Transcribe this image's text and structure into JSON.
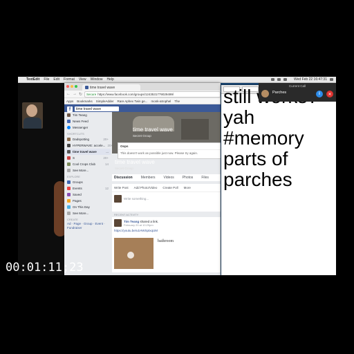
{
  "menubar": {
    "app": "TextEdit",
    "items": [
      "File",
      "Edit",
      "Format",
      "View",
      "Window",
      "Help"
    ],
    "clock": "Wed Feb 22  16:47:31"
  },
  "browser": {
    "tab_title": "time travel wave",
    "url_secure": "Secure",
    "url": "https://www.facebook.com/groups/1243531779029499/",
    "bookmarks": [
      "Apps",
      "Bookmarks",
      "SimpleAdder",
      "Rare Aphex Twin ge...",
      "monk-atrophel",
      "The"
    ]
  },
  "facebook": {
    "search_value": "time travel wave",
    "sidebar": {
      "user": "Tim Teang",
      "news_feed": "News Feed",
      "messenger": "Messenger",
      "shortcuts_header": "SHORTCUTS",
      "shortcuts": [
        {
          "label": "Dadspotting",
          "count": "20+"
        },
        {
          "label": "HYPERWAVE: accele...",
          "count": "20+"
        },
        {
          "label": "time travel wave",
          "count": "..."
        },
        {
          "label": "S",
          "count": "20+"
        },
        {
          "label": "Cool Crops Club",
          "count": "14"
        }
      ],
      "see_more_1": "See More...",
      "explore_header": "EXPLORE",
      "explore": [
        {
          "label": "Groups",
          "count": ""
        },
        {
          "label": "Events",
          "count": "12"
        },
        {
          "label": "Saved",
          "count": ""
        },
        {
          "label": "Pages",
          "count": ""
        },
        {
          "label": "On This Day",
          "count": ""
        }
      ],
      "see_more_2": "See More...",
      "create_header": "CREATE",
      "create_links": "Ad · Page · Group · Event · Fundraiser"
    },
    "cover": {
      "title": "time travel wave",
      "subtitle": "Secret Group"
    },
    "popup": {
      "title": "Oops",
      "message": "This doesn't work as possible just now. Please try again."
    },
    "group_title": "time travel wave",
    "group_subtitle": "Secret Group",
    "tabs": [
      "Discussion",
      "Members",
      "Videos",
      "Photos",
      "Files"
    ],
    "composer": {
      "write_post": "Write Post",
      "add_photo": "Add Photo/Video",
      "create_poll": "Create Poll",
      "more": "More",
      "placeholder": "Write something..."
    },
    "recent_activity": "RECENT ACTIVITY",
    "post": {
      "author": "Tim Teang",
      "action": "shared a link.",
      "time": "February 20 at 10:29pm",
      "link": "https://youtu.be/u1HWSptxqUM",
      "preview_title": "bathroom"
    }
  },
  "textedit": {
    "lines": [
      "still works?",
      "yah",
      "#memory",
      "parts of",
      "parches"
    ]
  },
  "call": {
    "label": "Current Call",
    "name": "Parches",
    "info": "i",
    "hangup": "✕"
  },
  "timecode": "00:01:11;23"
}
